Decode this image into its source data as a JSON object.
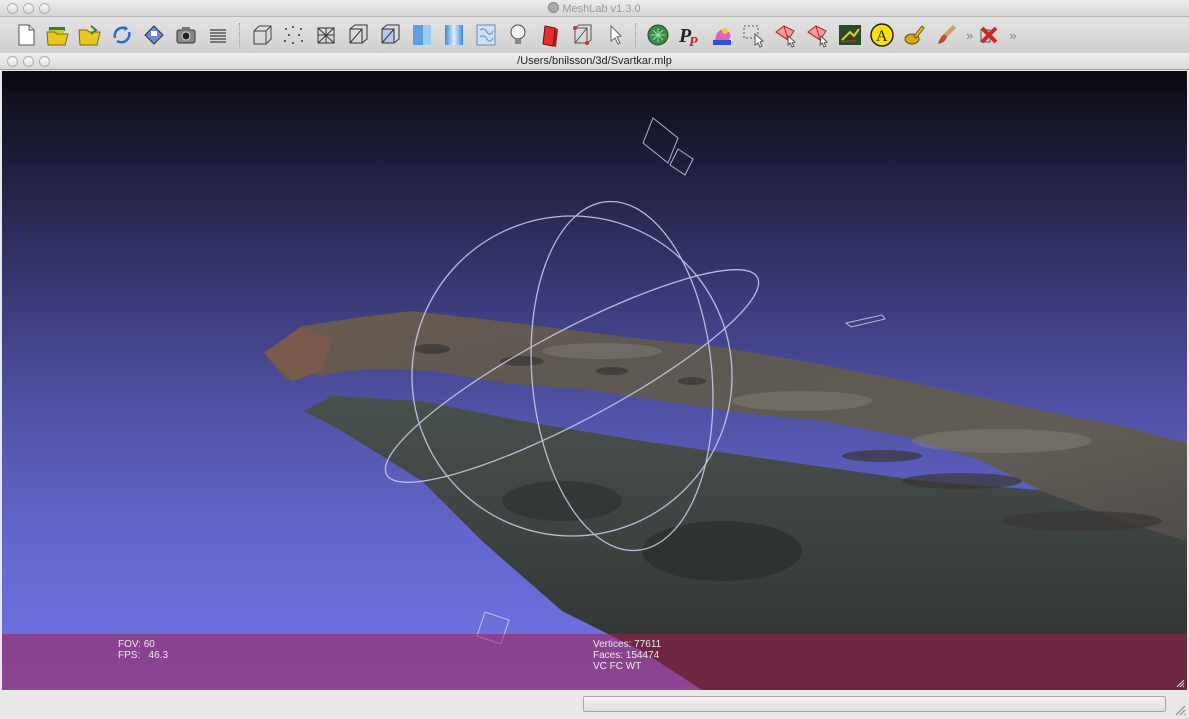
{
  "app": {
    "title": "MeshLab v1.3.0"
  },
  "document": {
    "title": "/Users/bnilsson/3d/Svartkar.mlp"
  },
  "toolbar": {
    "groups": [
      [
        "new-document-icon",
        "open-project-icon",
        "import-mesh-icon",
        "reload-icon",
        "save-icon",
        "snapshot-icon",
        "layers-icon"
      ],
      [
        "bounding-box-icon",
        "points-icon",
        "wireframe-icon",
        "hidden-lines-icon",
        "flat-lines-icon",
        "flat-shading-icon",
        "smooth-shading-icon",
        "texture-icon",
        "light-icon",
        "double-side-lighting-icon",
        "fancy-lighting-icon",
        "select-faces-icon"
      ],
      [
        "measure-tool-icon",
        "pickpoints-icon",
        "paint-icon",
        "select-vertexes-icon",
        "select-connected-icon",
        "move-selection-icon",
        "align-icon",
        "annotate-icon",
        "quality-mapper-icon",
        "brush-icon"
      ]
    ],
    "overflow_label": "»",
    "close_icon": "close-x-icon",
    "overflow2_label": "»"
  },
  "viewport": {
    "info": {
      "fov": "FOV: 60",
      "fps": "FPS:   46.3",
      "vertices": "Vertices: 77611",
      "faces": "Faces: 154474",
      "flags": "VC FC WT"
    }
  },
  "colors": {
    "info_bar": "#a01e50",
    "bg_top": "#0a0a12",
    "bg_bottom": "#7275e4",
    "trackball": "#c8c8e8"
  }
}
